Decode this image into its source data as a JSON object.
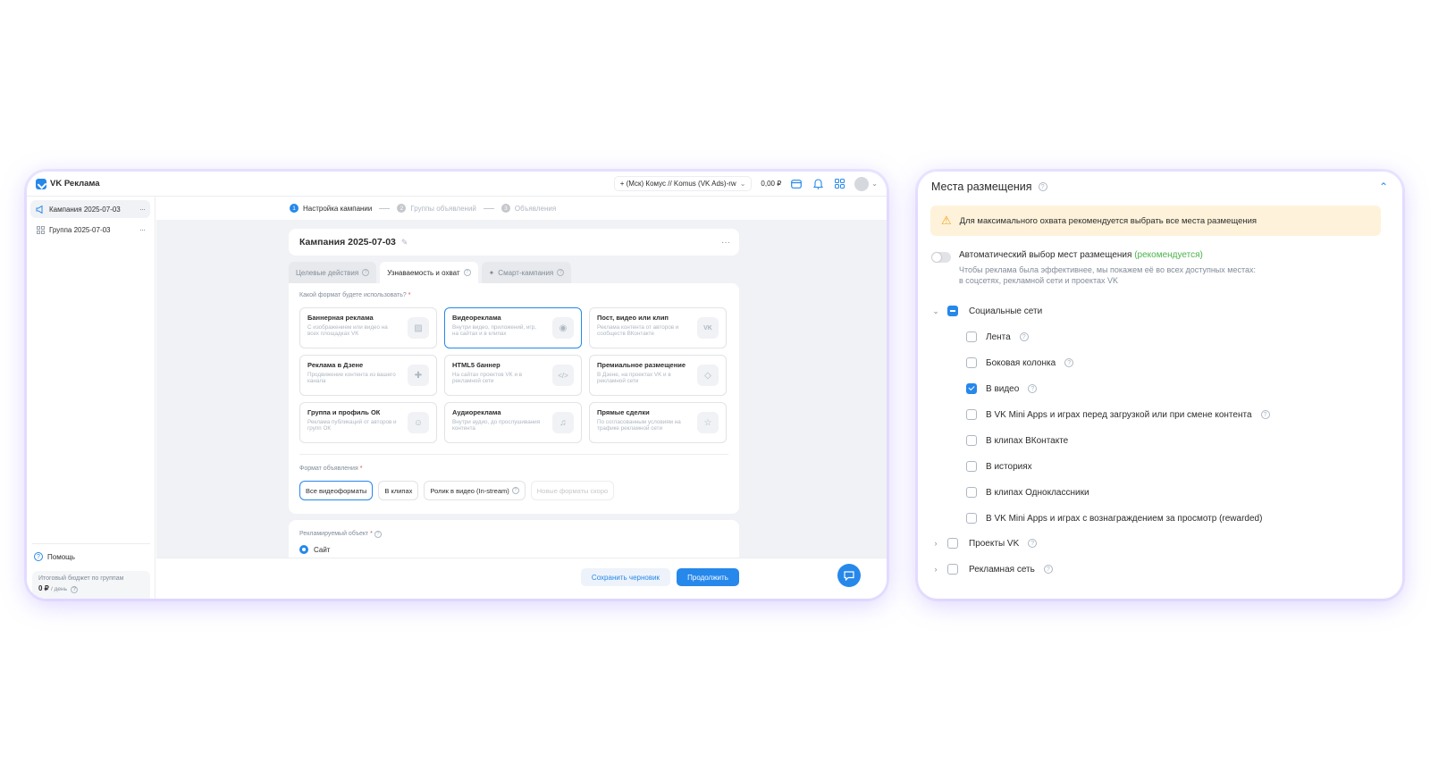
{
  "app": {
    "logo_text": "VK Реклама",
    "account": "+ (Мск) Комус // Komus (VK Ads)-rw",
    "balance": "0,00 ₽"
  },
  "sidebar": {
    "items": [
      {
        "label": "Кампания 2025-07-03"
      },
      {
        "label": "Группа 2025-07-03"
      }
    ],
    "help": "Помощь",
    "budget_title": "Итоговый бюджет по группам",
    "budget_value": "0 ₽",
    "budget_unit": "/ день"
  },
  "stepper": {
    "steps": [
      {
        "num": "1",
        "label": "Настройка кампании"
      },
      {
        "num": "2",
        "label": "Группы объявлений"
      },
      {
        "num": "3",
        "label": "Объявления"
      }
    ]
  },
  "campaign": {
    "name": "Кампания 2025-07-03"
  },
  "goal_tabs": [
    {
      "label": "Целевые действия"
    },
    {
      "label": "Узнаваемость и охват"
    },
    {
      "label": "Смарт-кампания"
    }
  ],
  "format": {
    "question": "Какой формат будете использовать?",
    "required_mark": "*",
    "options": [
      {
        "title": "Баннерная реклама",
        "desc": "С изображением или видео на всех площадках VK",
        "icon": "image-icon"
      },
      {
        "title": "Видеореклама",
        "desc": "Внутри видео, приложений, игр, на сайтах и в клипах",
        "icon": "play-icon"
      },
      {
        "title": "Пост, видео или клип",
        "desc": "Реклама контента от авторов и сообществ ВКонтакте",
        "icon": "vk-icon"
      },
      {
        "title": "Реклама в Дзене",
        "desc": "Продвижение контента из вашего канала",
        "icon": "dzen-icon"
      },
      {
        "title": "HTML5 баннер",
        "desc": "На сайтах проектов VK и в рекламной сети",
        "icon": "code-icon"
      },
      {
        "title": "Премиальное размещение",
        "desc": "В Дзене, на проектах VK и в рекламной сети",
        "icon": "diamond-icon"
      },
      {
        "title": "Группа и профиль ОК",
        "desc": "Реклама публикаций от авторов и групп ОК",
        "icon": "ok-icon"
      },
      {
        "title": "Аудиореклама",
        "desc": "Внутри аудио, до прослушивания контента",
        "icon": "headphones-icon"
      },
      {
        "title": "Прямые сделки",
        "desc": "По согласованным условиям на трафике рекламной сети",
        "icon": "star-icon"
      }
    ],
    "ad_format_label": "Формат объявления",
    "ad_formats": [
      {
        "label": "Все видеоформаты"
      },
      {
        "label": "В клипах"
      },
      {
        "label": "Ролик в видео (In-stream)"
      },
      {
        "label": "Новые форматы скоро"
      }
    ]
  },
  "object": {
    "label": "Рекламируемый объект",
    "option": "Сайт"
  },
  "buttons": {
    "draft": "Сохранить черновик",
    "continue": "Продолжить"
  },
  "placements": {
    "title": "Места размещения",
    "warning": "Для максимального охвата рекомендуется выбрать все места размещения",
    "auto_title": "Автоматический выбор мест размещения",
    "auto_recommended": "(рекомендуется)",
    "auto_desc_1": "Чтобы реклама была эффективнее, мы покажем её во всех доступных местах:",
    "auto_desc_2": "в соцсетях, рекламной сети и проектах VK",
    "social": "Социальные сети",
    "social_items": [
      {
        "label": "Лента",
        "checked": false
      },
      {
        "label": "Боковая колонка",
        "checked": false
      },
      {
        "label": "В видео",
        "checked": true
      },
      {
        "label": "В VK Mini Apps и играх перед загрузкой или при смене контента",
        "checked": false
      },
      {
        "label": "В клипах ВКонтакте",
        "checked": false
      },
      {
        "label": "В историях",
        "checked": false
      },
      {
        "label": "В клипах Одноклассники",
        "checked": false
      },
      {
        "label": "В VK Mini Apps и играх с вознаграждением за просмотр (rewarded)",
        "checked": false
      }
    ],
    "vk_projects": "Проекты VK",
    "ad_network": "Рекламная сеть"
  },
  "colors": {
    "accent": "#2688eb",
    "warning_bg": "#fef3da",
    "recommend": "#4bb34b"
  }
}
